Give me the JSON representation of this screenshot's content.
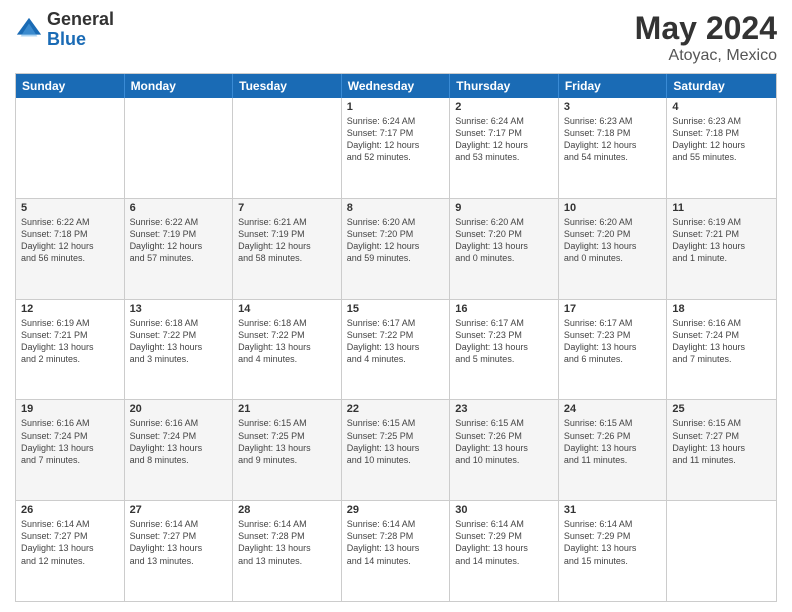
{
  "logo": {
    "general": "General",
    "blue": "Blue"
  },
  "header": {
    "title": "May 2024",
    "subtitle": "Atoyac, Mexico"
  },
  "days_of_week": [
    "Sunday",
    "Monday",
    "Tuesday",
    "Wednesday",
    "Thursday",
    "Friday",
    "Saturday"
  ],
  "weeks": [
    {
      "alt": false,
      "cells": [
        {
          "day": "",
          "info": ""
        },
        {
          "day": "",
          "info": ""
        },
        {
          "day": "",
          "info": ""
        },
        {
          "day": "1",
          "info": "Sunrise: 6:24 AM\nSunset: 7:17 PM\nDaylight: 12 hours\nand 52 minutes."
        },
        {
          "day": "2",
          "info": "Sunrise: 6:24 AM\nSunset: 7:17 PM\nDaylight: 12 hours\nand 53 minutes."
        },
        {
          "day": "3",
          "info": "Sunrise: 6:23 AM\nSunset: 7:18 PM\nDaylight: 12 hours\nand 54 minutes."
        },
        {
          "day": "4",
          "info": "Sunrise: 6:23 AM\nSunset: 7:18 PM\nDaylight: 12 hours\nand 55 minutes."
        }
      ]
    },
    {
      "alt": true,
      "cells": [
        {
          "day": "5",
          "info": "Sunrise: 6:22 AM\nSunset: 7:18 PM\nDaylight: 12 hours\nand 56 minutes."
        },
        {
          "day": "6",
          "info": "Sunrise: 6:22 AM\nSunset: 7:19 PM\nDaylight: 12 hours\nand 57 minutes."
        },
        {
          "day": "7",
          "info": "Sunrise: 6:21 AM\nSunset: 7:19 PM\nDaylight: 12 hours\nand 58 minutes."
        },
        {
          "day": "8",
          "info": "Sunrise: 6:20 AM\nSunset: 7:20 PM\nDaylight: 12 hours\nand 59 minutes."
        },
        {
          "day": "9",
          "info": "Sunrise: 6:20 AM\nSunset: 7:20 PM\nDaylight: 13 hours\nand 0 minutes."
        },
        {
          "day": "10",
          "info": "Sunrise: 6:20 AM\nSunset: 7:20 PM\nDaylight: 13 hours\nand 0 minutes."
        },
        {
          "day": "11",
          "info": "Sunrise: 6:19 AM\nSunset: 7:21 PM\nDaylight: 13 hours\nand 1 minute."
        }
      ]
    },
    {
      "alt": false,
      "cells": [
        {
          "day": "12",
          "info": "Sunrise: 6:19 AM\nSunset: 7:21 PM\nDaylight: 13 hours\nand 2 minutes."
        },
        {
          "day": "13",
          "info": "Sunrise: 6:18 AM\nSunset: 7:22 PM\nDaylight: 13 hours\nand 3 minutes."
        },
        {
          "day": "14",
          "info": "Sunrise: 6:18 AM\nSunset: 7:22 PM\nDaylight: 13 hours\nand 4 minutes."
        },
        {
          "day": "15",
          "info": "Sunrise: 6:17 AM\nSunset: 7:22 PM\nDaylight: 13 hours\nand 4 minutes."
        },
        {
          "day": "16",
          "info": "Sunrise: 6:17 AM\nSunset: 7:23 PM\nDaylight: 13 hours\nand 5 minutes."
        },
        {
          "day": "17",
          "info": "Sunrise: 6:17 AM\nSunset: 7:23 PM\nDaylight: 13 hours\nand 6 minutes."
        },
        {
          "day": "18",
          "info": "Sunrise: 6:16 AM\nSunset: 7:24 PM\nDaylight: 13 hours\nand 7 minutes."
        }
      ]
    },
    {
      "alt": true,
      "cells": [
        {
          "day": "19",
          "info": "Sunrise: 6:16 AM\nSunset: 7:24 PM\nDaylight: 13 hours\nand 7 minutes."
        },
        {
          "day": "20",
          "info": "Sunrise: 6:16 AM\nSunset: 7:24 PM\nDaylight: 13 hours\nand 8 minutes."
        },
        {
          "day": "21",
          "info": "Sunrise: 6:15 AM\nSunset: 7:25 PM\nDaylight: 13 hours\nand 9 minutes."
        },
        {
          "day": "22",
          "info": "Sunrise: 6:15 AM\nSunset: 7:25 PM\nDaylight: 13 hours\nand 10 minutes."
        },
        {
          "day": "23",
          "info": "Sunrise: 6:15 AM\nSunset: 7:26 PM\nDaylight: 13 hours\nand 10 minutes."
        },
        {
          "day": "24",
          "info": "Sunrise: 6:15 AM\nSunset: 7:26 PM\nDaylight: 13 hours\nand 11 minutes."
        },
        {
          "day": "25",
          "info": "Sunrise: 6:15 AM\nSunset: 7:27 PM\nDaylight: 13 hours\nand 11 minutes."
        }
      ]
    },
    {
      "alt": false,
      "cells": [
        {
          "day": "26",
          "info": "Sunrise: 6:14 AM\nSunset: 7:27 PM\nDaylight: 13 hours\nand 12 minutes."
        },
        {
          "day": "27",
          "info": "Sunrise: 6:14 AM\nSunset: 7:27 PM\nDaylight: 13 hours\nand 13 minutes."
        },
        {
          "day": "28",
          "info": "Sunrise: 6:14 AM\nSunset: 7:28 PM\nDaylight: 13 hours\nand 13 minutes."
        },
        {
          "day": "29",
          "info": "Sunrise: 6:14 AM\nSunset: 7:28 PM\nDaylight: 13 hours\nand 14 minutes."
        },
        {
          "day": "30",
          "info": "Sunrise: 6:14 AM\nSunset: 7:29 PM\nDaylight: 13 hours\nand 14 minutes."
        },
        {
          "day": "31",
          "info": "Sunrise: 6:14 AM\nSunset: 7:29 PM\nDaylight: 13 hours\nand 15 minutes."
        },
        {
          "day": "",
          "info": ""
        }
      ]
    }
  ]
}
